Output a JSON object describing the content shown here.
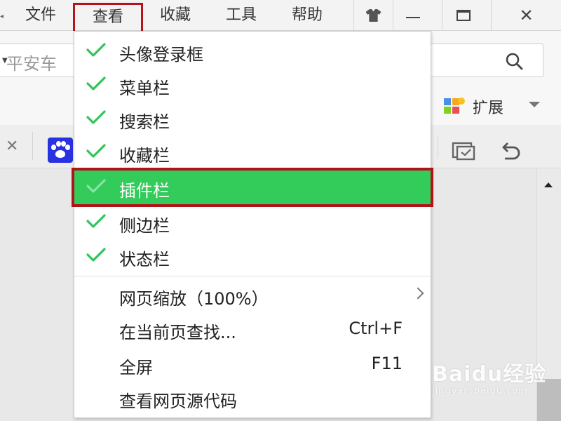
{
  "menubar": {
    "items": [
      {
        "label": "文件"
      },
      {
        "label": "查看"
      },
      {
        "label": "收藏"
      },
      {
        "label": "工具"
      },
      {
        "label": "帮助"
      }
    ],
    "active_index": 1
  },
  "window_controls": [
    "skin-icon",
    "minimize-icon",
    "maximize-icon",
    "close-icon"
  ],
  "address_bar": {
    "value": "平安车"
  },
  "extension": {
    "label": "扩展"
  },
  "view_menu": {
    "toggles": [
      {
        "label": "头像登录框",
        "checked": true
      },
      {
        "label": "菜单栏",
        "checked": true
      },
      {
        "label": "搜索栏",
        "checked": true
      },
      {
        "label": "收藏栏",
        "checked": true
      },
      {
        "label": "插件栏",
        "checked": true,
        "highlighted": true
      },
      {
        "label": "侧边栏",
        "checked": true
      },
      {
        "label": "状态栏",
        "checked": true
      }
    ],
    "actions": [
      {
        "label": "网页缩放（100%）",
        "has_submenu": true
      },
      {
        "label": "在当前页查找...",
        "shortcut": "Ctrl+F"
      },
      {
        "label": "全屏",
        "shortcut": "F11"
      },
      {
        "label": "查看网页源代码"
      }
    ]
  },
  "watermark": {
    "main": "Baidu经验",
    "sub": "jingyan.baidu.com"
  },
  "colors": {
    "check_green": "#33c35b",
    "highlight_green": "#33cc5a",
    "annotation_red": "#b5141c",
    "baidu_blue": "#2932e1"
  }
}
